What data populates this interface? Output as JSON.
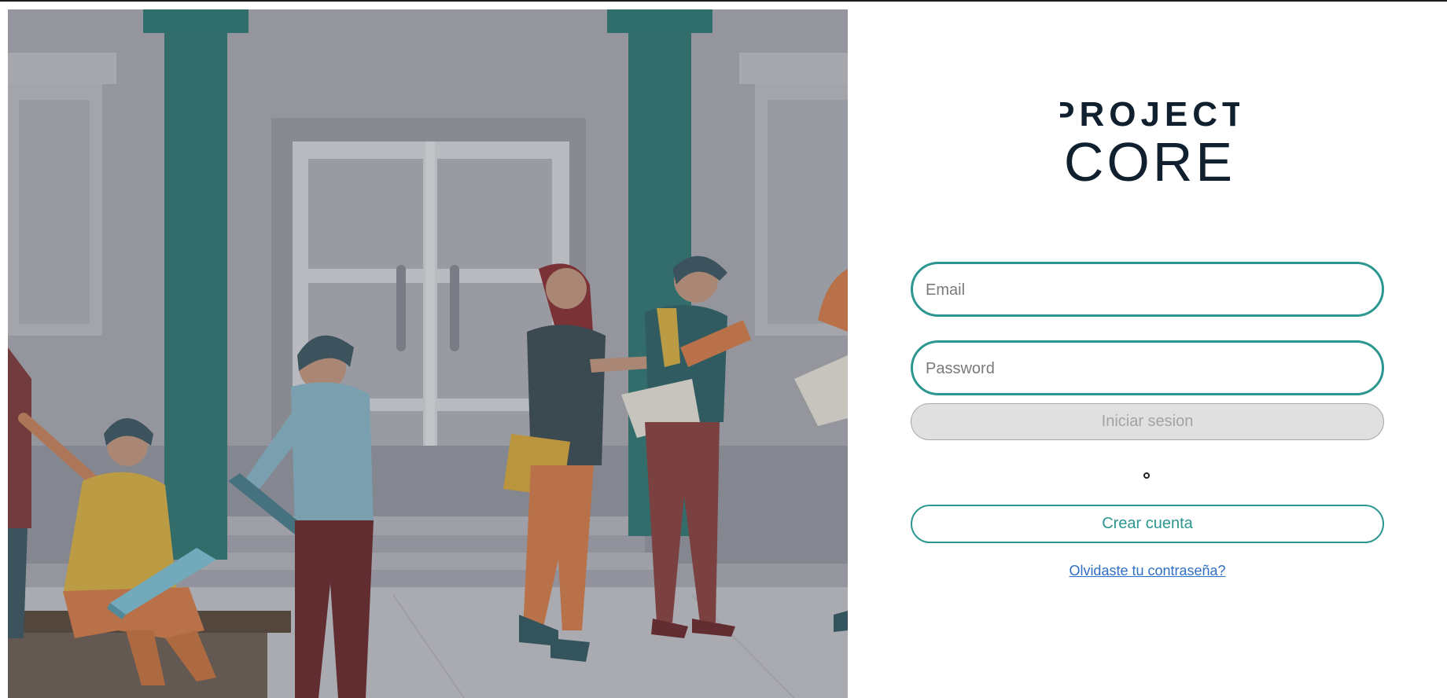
{
  "logo": {
    "line1": "PROJECT",
    "line2": "CORE",
    "color": "#10202e"
  },
  "form": {
    "email_placeholder": "Email",
    "password_placeholder": "Password",
    "login_label": "Iniciar sesion",
    "create_account_label": "Crear cuenta",
    "forgot_password_label": "Olvidaste tu contraseña?"
  },
  "colors": {
    "accent": "#2b9790",
    "link": "#2f6fc4",
    "disabled_bg": "#e0e0e0",
    "disabled_text": "#a3a3a3"
  },
  "hero": {
    "icon": "students-campus-illustration"
  }
}
